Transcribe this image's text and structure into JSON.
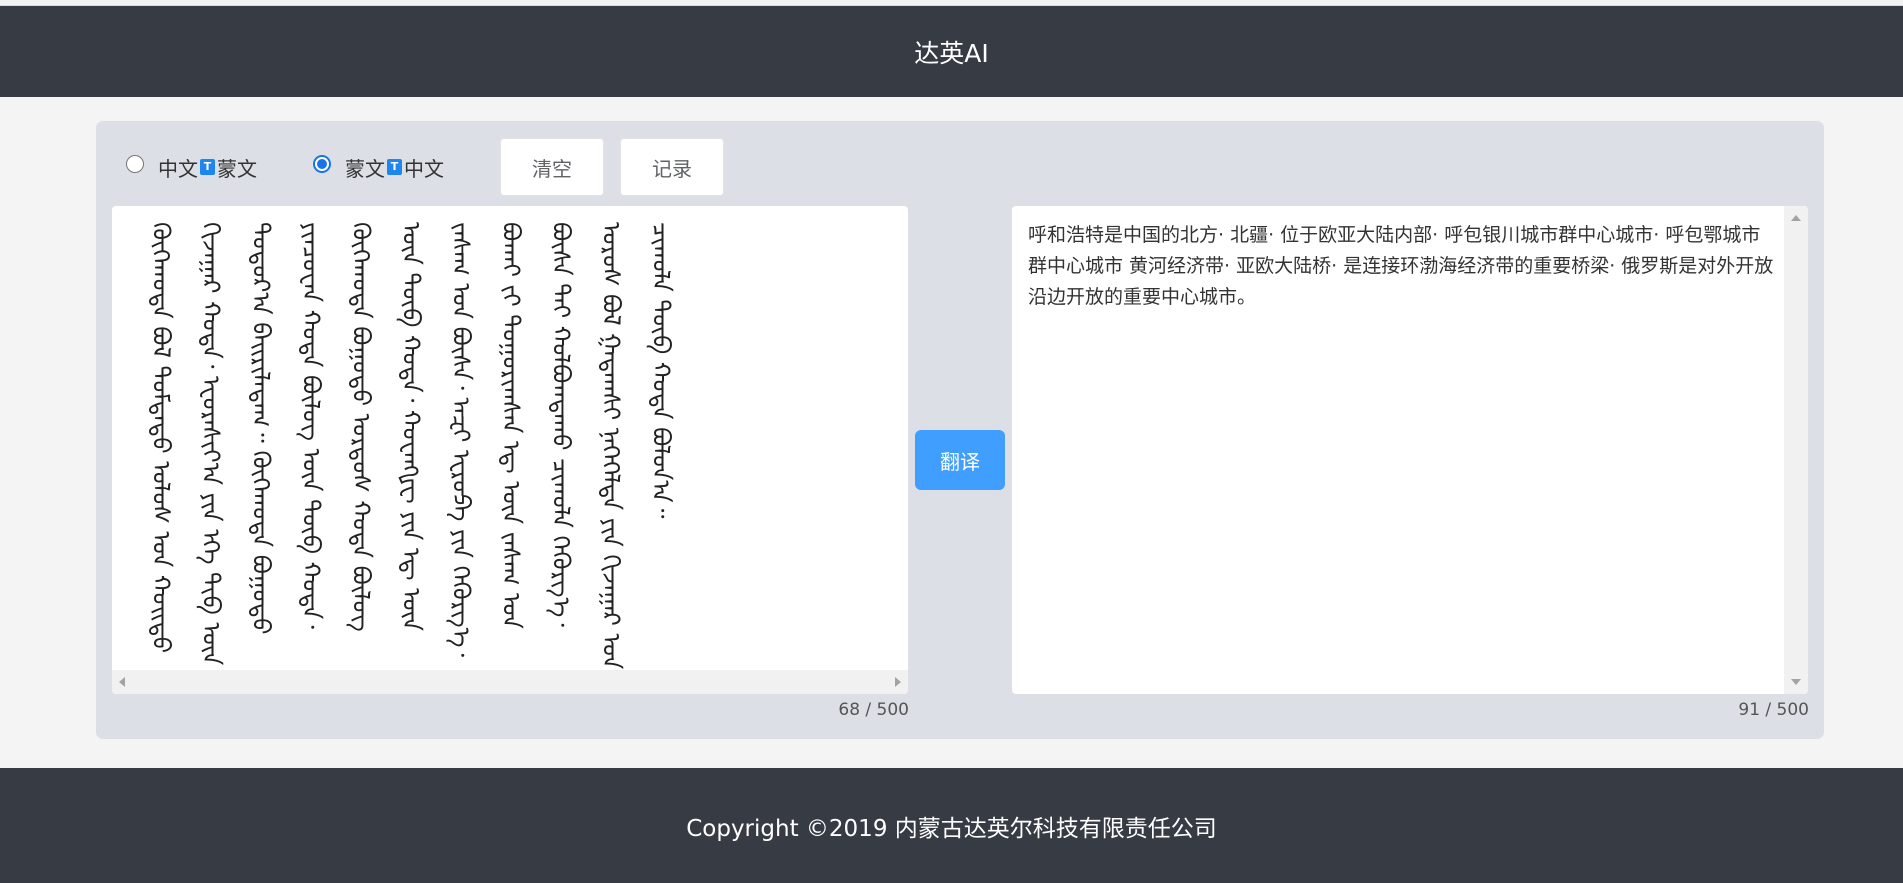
{
  "header": {
    "title": "达英AI"
  },
  "options": {
    "zh_to_mn": {
      "from": "中文",
      "badge": "T",
      "to": "蒙文",
      "checked": false
    },
    "mn_to_zh": {
      "from": "蒙文",
      "badge": "T",
      "to": "中文",
      "checked": true
    }
  },
  "buttons": {
    "clear": "清空",
    "history": "记录",
    "translate": "翻译"
  },
  "source": {
    "text": "ᠬᠥᠬᠡᠬᠣᠲᠠ ᠪᠣᠯ ᠳᠤᠮᠳᠠᠳᠤ ᠤᠯᠤᠰ ᠤᠨ ᠬᠣᠢᠲᠤ ᠬᠢᠵᠠᠭᠠᠷ ᠬᠣᠲᠠ᠂ ᠡᠸᠦᠷᠠᠰᠢᠶ᠎ᠠ ᠶᠢᠨ ᠡᠬᠡ ᠲᠢᠪ ᠦᠨ ᠳᠣᠲᠣᠷ᠎ᠠ ᠪᠠᠢᠷᠢᠯᠠᠳᠠᠭ᠃ ᠬᠥᠬᠡᠬᠣᠲᠠ ᠪᠣᠭᠣᠲᠣ ᠶᠢᠨᠴᠤᠸᠠᠨ ᠬᠣᠲᠠ ᠪᠦᠯᠦᠭ ᠦᠨ ᠲᠥᠪ ᠬᠣᠲᠠ᠂ ᠬᠥᠬᠡᠬᠣᠲᠠ ᠪᠣᠭᠣᠲᠣ ᠣᠷᠳᠣᠰ ᠬᠣᠲᠠ ᠪᠦᠯᠦᠭ ᠦᠨ ᠲᠥᠪ ᠬᠣᠲᠠ᠂ ᠬᠤᠸᠠᠩᠾᠧ ᠶᠢᠨ ᠡᠳ᠋ ᠦᠨ ᠵᠠᠰᠠᠭ ᠤᠨ ᠪᠦᠰᠡ᠂ ᠠᠽᠢ ᠡᠸᠷᠤᠫᠠ ᠶᠢᠨ ᠬᠡᠭᠦᠷᠭ᠎ᠡ᠂ ᠪᠣᠬᠠᠢ ᠵᠢ ᠲᠣᠭᠣᠷᠢᠭᠰᠠᠨ ᠡᠳ᠋ ᠦᠨ ᠵᠠᠰᠠᠭ ᠤᠨ ᠪᠦᠰᠡ ᠲᠡᠢ ᠬᠣᠯᠪᠣᠭᠳᠠᠬᠤ ᠴᠢᠬᠤᠯᠠ ᠬᠡᠭᠦᠷᠭ᠎ᠡ᠂ ᠣᠷᠣᠰ ᠪᠣᠯ ᠭᠠᠳᠠᠭᠰᠢ ᠨᠡᠭᠡᠭᠡᠯᠲᠡ ᠶᠢᠨ ᠬᠢᠵᠠᠭᠠᠷ ᠤᠨ ᠴᠢᠬᠤᠯᠠ ᠲᠥᠪ ᠬᠣᠲᠠ ᠪᠣᠯᠣᠨ᠎ᠠ᠃",
    "count": "68 / 500"
  },
  "result": {
    "text": "呼和浩特是中国的北方· 北疆· 位于欧亚大陆内部· 呼包银川城市群中心城市· 呼包鄂城市群中心城市 黄河经济带· 亚欧大陆桥· 是连接环渤海经济带的重要桥梁· 俄罗斯是对外开放沿边开放的重要中心城市。",
    "count": "91 / 500"
  },
  "footer": {
    "copyright": "Copyright ©2019 内蒙古达英尔科技有限责任公司"
  },
  "colors": {
    "header_bg": "#363b44",
    "panel_bg": "#dcdfe6",
    "accent": "#409eff"
  }
}
